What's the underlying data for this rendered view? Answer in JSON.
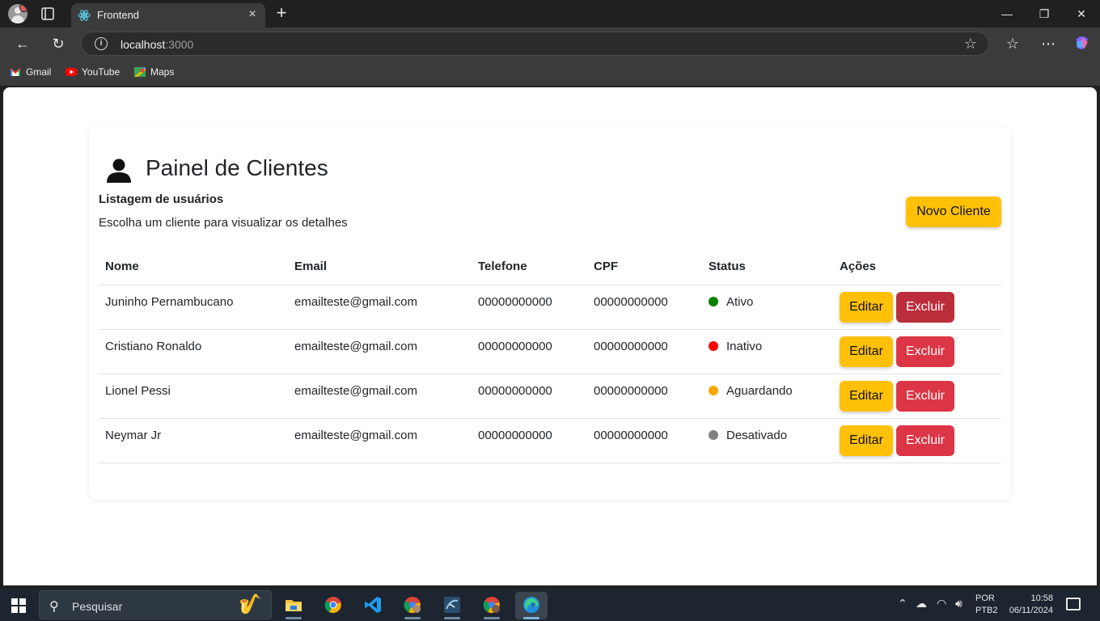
{
  "browser": {
    "tab_title": "Frontend",
    "url_host": "localhost",
    "url_port": ":3000",
    "bookmarks": [
      "Gmail",
      "YouTube",
      "Maps"
    ]
  },
  "page": {
    "title": "Painel de Clientes",
    "subtitle": "Listagem de usuários",
    "description": "Escolha um cliente para visualizar os detalhes",
    "new_button": "Novo Cliente",
    "columns": [
      "Nome",
      "Email",
      "Telefone",
      "CPF",
      "Status",
      "Ações"
    ],
    "rows": [
      {
        "name": "Juninho Pernambucano",
        "email": "emailteste@gmail.com",
        "phone": "00000000000",
        "cpf": "00000000000",
        "status": "Ativo",
        "status_color": "#008000"
      },
      {
        "name": "Cristiano Ronaldo",
        "email": "emailteste@gmail.com",
        "phone": "00000000000",
        "cpf": "00000000000",
        "status": "Inativo",
        "status_color": "#ff0000"
      },
      {
        "name": "Lionel Pessi",
        "email": "emailteste@gmail.com",
        "phone": "00000000000",
        "cpf": "00000000000",
        "status": "Aguardando",
        "status_color": "#ffa500"
      },
      {
        "name": "Neymar Jr",
        "email": "emailteste@gmail.com",
        "phone": "00000000000",
        "cpf": "00000000000",
        "status": "Desativado",
        "status_color": "#808080"
      }
    ],
    "edit_label": "Editar",
    "delete_label": "Excluir"
  },
  "taskbar": {
    "search_placeholder": "Pesquisar",
    "lang_top": "POR",
    "lang_bottom": "PTB2",
    "time": "10:58",
    "date": "06/11/2024"
  },
  "colors": {
    "warning": "#ffc107",
    "danger": "#dc3545"
  }
}
